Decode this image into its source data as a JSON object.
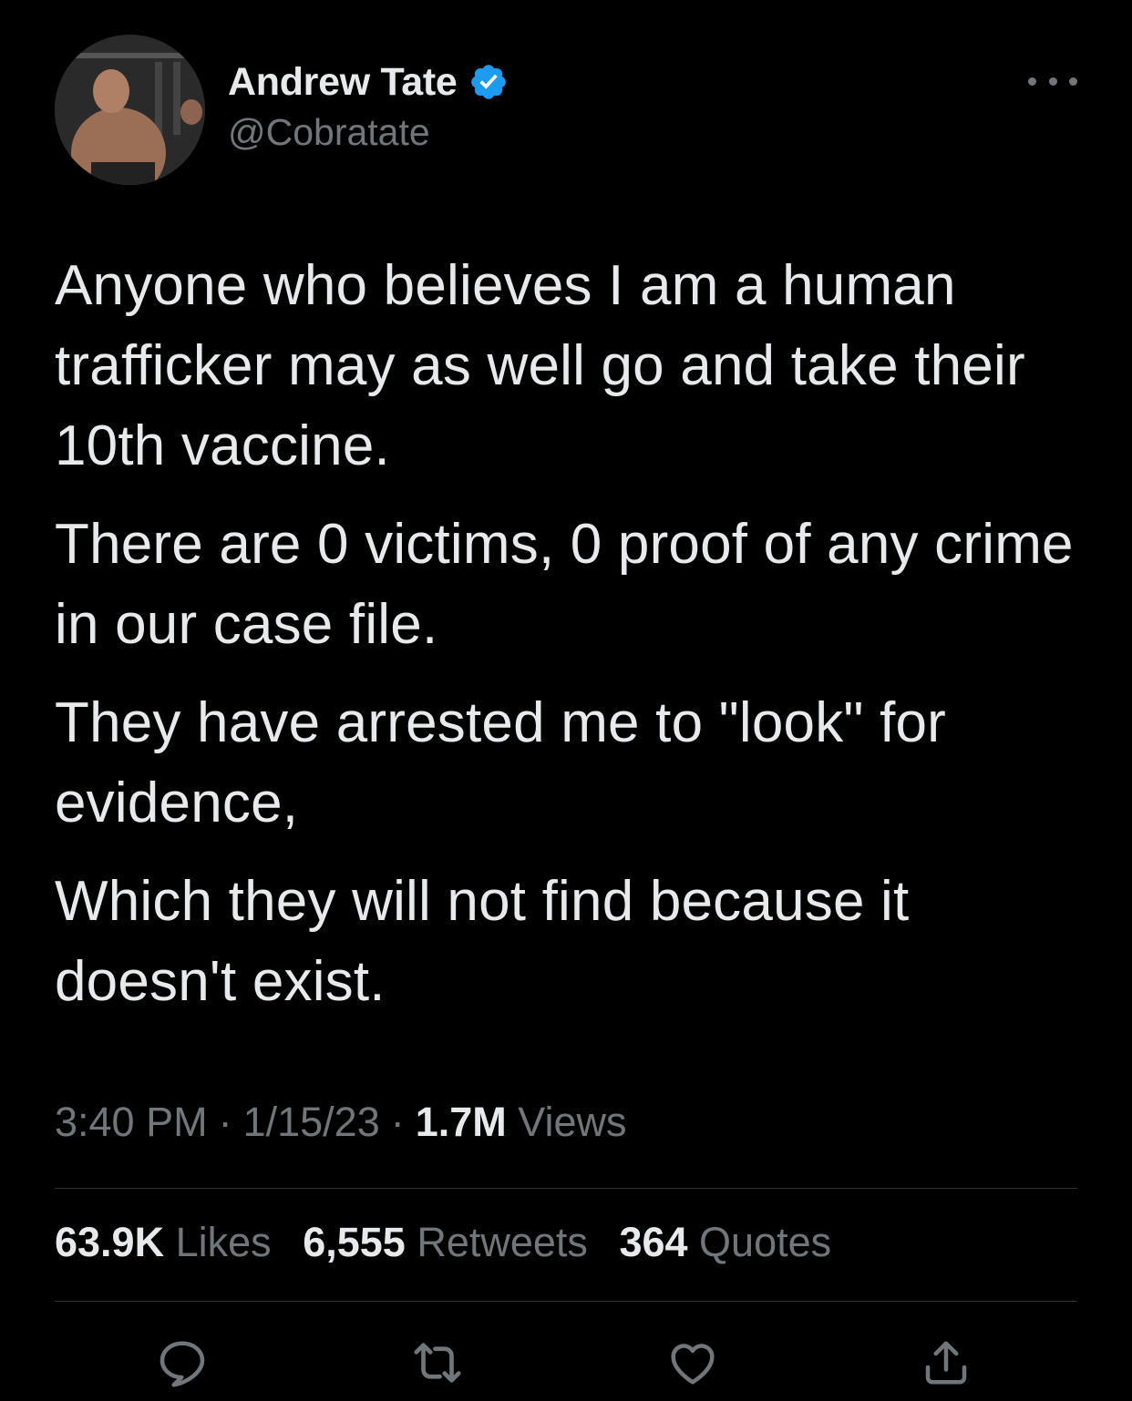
{
  "author": {
    "display_name": "Andrew Tate",
    "handle": "@Cobratate",
    "verified": true
  },
  "tweet": {
    "paragraphs": [
      "Anyone who believes I am a human trafficker may as well go and take their 10th vaccine.",
      "There are 0 victims, 0 proof of any crime in our case file.",
      "They have arrested me to \"look\" for evidence,",
      "Which they will not find because it doesn't exist."
    ],
    "time": "3:40 PM",
    "date": "1/15/23",
    "separator": "·",
    "views_count": "1.7M",
    "views_label": "Views"
  },
  "stats": {
    "likes_count": "63.9K",
    "likes_label": "Likes",
    "retweets_count": "6,555",
    "retweets_label": "Retweets",
    "quotes_count": "364",
    "quotes_label": "Quotes"
  },
  "icons": {
    "verified": "verified-badge-icon",
    "more": "more-options-icon",
    "reply": "reply-icon",
    "retweet": "retweet-icon",
    "like": "heart-icon",
    "share": "share-icon"
  },
  "colors": {
    "background": "#000000",
    "text_primary": "#e7e9ea",
    "text_secondary": "#71767b",
    "verified_blue": "#1d9bf0",
    "divider": "#2f3336"
  }
}
